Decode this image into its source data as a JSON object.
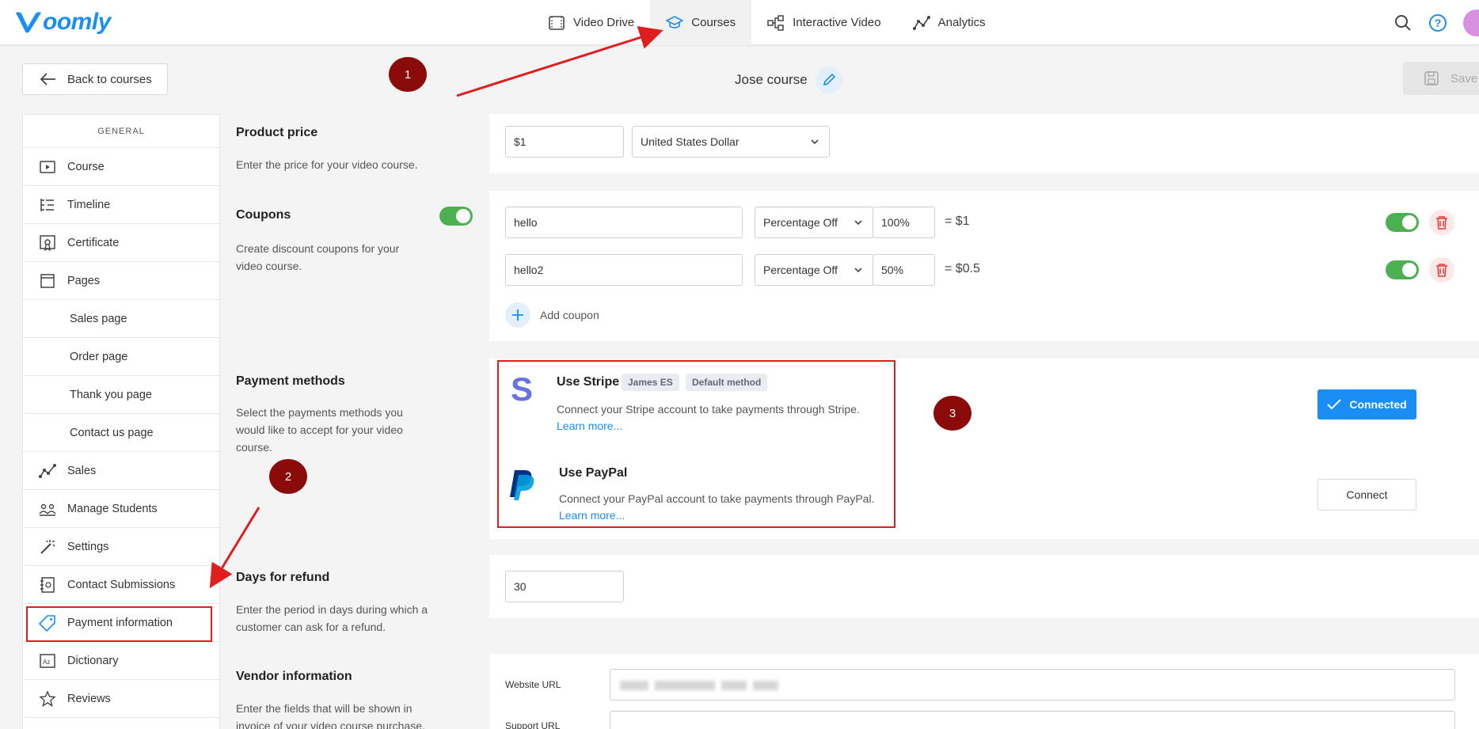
{
  "header": {
    "logo_text": "oomly",
    "nav": [
      {
        "label": "Video Drive",
        "icon": "video-drive-icon"
      },
      {
        "label": "Courses",
        "icon": "graduation-cap-icon",
        "active": true
      },
      {
        "label": "Interactive Video",
        "icon": "flow-icon"
      },
      {
        "label": "Analytics",
        "icon": "analytics-icon"
      }
    ]
  },
  "toolbar": {
    "back_label": "Back to courses",
    "course_title": "Jose course",
    "save_label": "Save"
  },
  "sidebar": {
    "heading": "GENERAL",
    "items": [
      {
        "label": "Course",
        "icon": "play-box-icon"
      },
      {
        "label": "Timeline",
        "icon": "timeline-icon"
      },
      {
        "label": "Certificate",
        "icon": "certificate-icon"
      },
      {
        "label": "Pages",
        "icon": "page-icon"
      },
      {
        "label": "Sales page"
      },
      {
        "label": "Order page"
      },
      {
        "label": "Thank you page"
      },
      {
        "label": "Contact us page"
      },
      {
        "label": "Sales",
        "icon": "sales-icon"
      },
      {
        "label": "Manage Students",
        "icon": "students-icon"
      },
      {
        "label": "Settings",
        "icon": "wand-icon"
      },
      {
        "label": "Contact Submissions",
        "icon": "contact-icon"
      },
      {
        "label": "Payment information",
        "icon": "tag-icon",
        "highlighted": true
      },
      {
        "label": "Dictionary",
        "icon": "dictionary-icon"
      },
      {
        "label": "Reviews",
        "icon": "star-icon"
      }
    ]
  },
  "price": {
    "title": "Product price",
    "desc": "Enter the price for your video course.",
    "value": "$1",
    "currency": "United States Dollar"
  },
  "coupons": {
    "title": "Coupons",
    "desc": "Create discount coupons for your video course.",
    "rows": [
      {
        "code": "hello",
        "type": "Percentage Off",
        "amount": "100%",
        "result": "= $1"
      },
      {
        "code": "hello2",
        "type": "Percentage Off",
        "amount": "50%",
        "result": "= $0.5"
      }
    ],
    "add_label": "Add coupon"
  },
  "payments": {
    "title": "Payment methods",
    "desc": "Select the payments methods you would like to accept for your video course.",
    "stripe": {
      "name": "Use Stripe",
      "badge_account": "James ES",
      "badge_default": "Default method",
      "desc": "Connect your Stripe account to take payments through Stripe.",
      "learn": "Learn more...",
      "button": "Connected"
    },
    "paypal": {
      "name": "Use PayPal",
      "desc": "Connect your PayPal account to take payments through PayPal.",
      "learn": "Learn more...",
      "button": "Connect"
    }
  },
  "refund": {
    "title": "Days for refund",
    "desc": "Enter the period in days during which a customer can ask for a refund.",
    "value": "30"
  },
  "vendor": {
    "title": "Vendor information",
    "desc": "Enter the fields that will be shown in invoice of your video course purchase.",
    "website_label": "Website URL",
    "support_label": "Support URL"
  },
  "annotations": {
    "m1": "1",
    "m2": "2",
    "m3": "3"
  },
  "colors": {
    "accent": "#1a8ef5",
    "toggle_on": "#4caf50",
    "annotation": "#8b0a0a",
    "highlight_box": "#e11e1e"
  }
}
